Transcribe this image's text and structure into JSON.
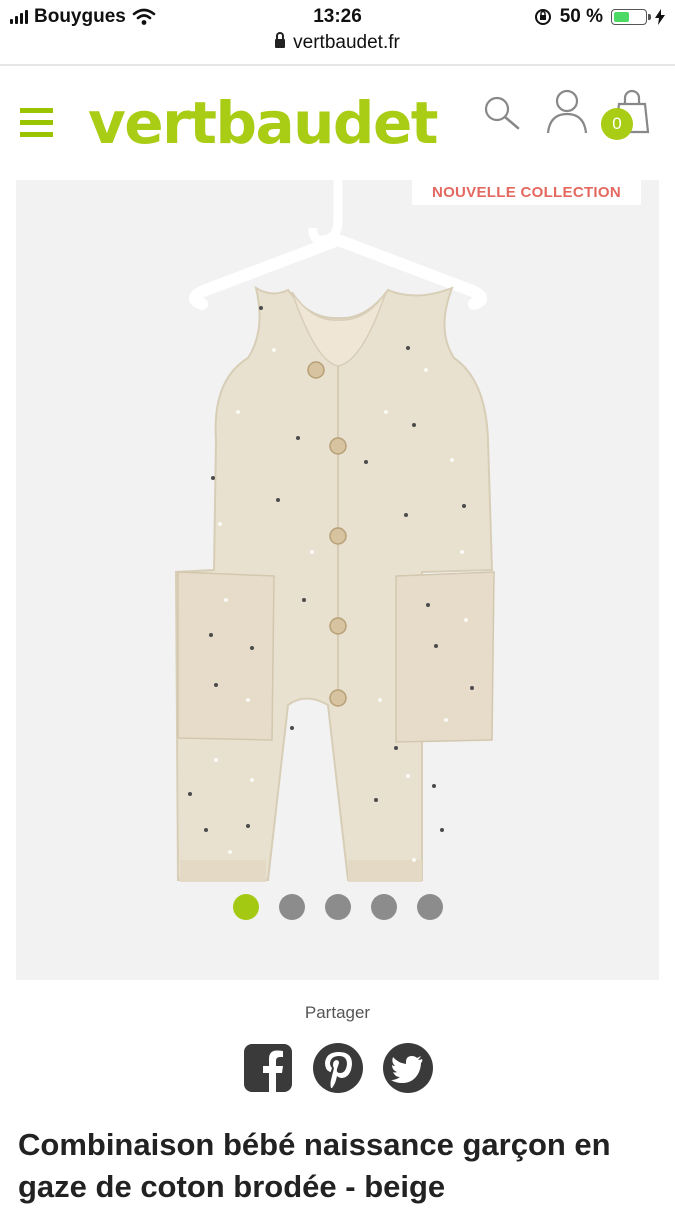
{
  "status_bar": {
    "carrier": "Bouygues",
    "time": "13:26",
    "battery_percent": "50 %",
    "battery_level": 0.5,
    "url": "vertbaudet.fr"
  },
  "header": {
    "logo_text": "vertbaudet",
    "cart_count": "0"
  },
  "product": {
    "badge": "NOUVELLE COLLECTION",
    "image_count": 5,
    "active_image_index": 0,
    "title": "Combinaison bébé naissance garçon en gaze de coton brodée - beige"
  },
  "share": {
    "label": "Partager",
    "networks": [
      "facebook",
      "pinterest",
      "twitter"
    ]
  },
  "colors": {
    "brand_green": "#a9cc15",
    "badge_red": "#e4685f"
  }
}
